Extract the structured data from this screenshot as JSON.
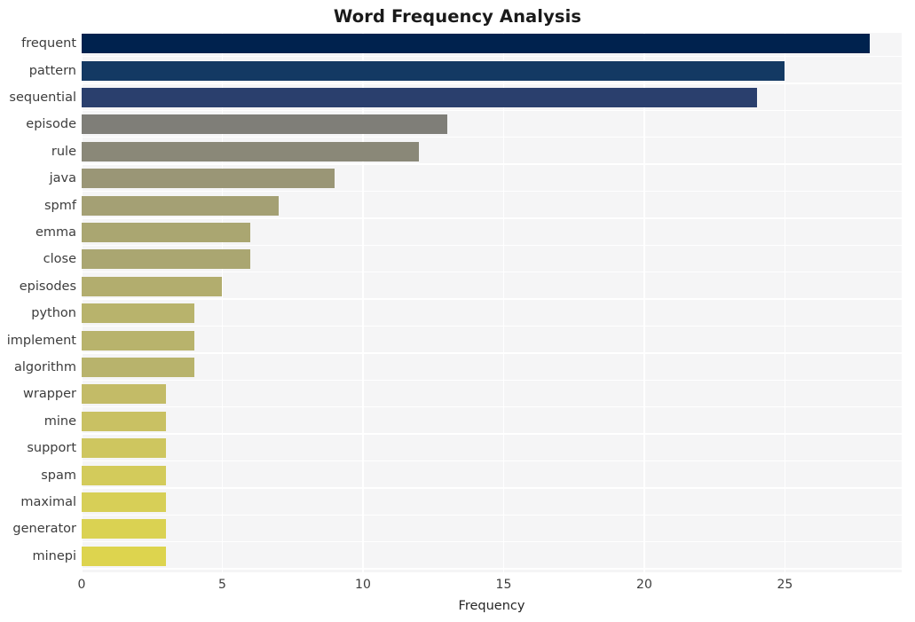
{
  "chart_data": {
    "type": "bar",
    "orientation": "horizontal",
    "title": "Word Frequency Analysis",
    "xlabel": "Frequency",
    "ylabel": "",
    "categories": [
      "frequent",
      "pattern",
      "sequential",
      "episode",
      "rule",
      "java",
      "spmf",
      "emma",
      "close",
      "episodes",
      "python",
      "implement",
      "algorithm",
      "wrapper",
      "mine",
      "support",
      "spam",
      "maximal",
      "generator",
      "minepi"
    ],
    "values": [
      28,
      25,
      24,
      13,
      12,
      9,
      7,
      6,
      6,
      5,
      4,
      4,
      4,
      3,
      3,
      3,
      3,
      3,
      3,
      3
    ],
    "bar_colors": [
      "#00224e",
      "#133963",
      "#2a3f6d",
      "#7f7e78",
      "#8a8878",
      "#9a9676",
      "#a4a074",
      "#aaa671",
      "#aaa671",
      "#b2ad6e",
      "#b8b36c",
      "#b8b36c",
      "#b8b36c",
      "#c3bb67",
      "#c9c163",
      "#cec65f",
      "#d3cb5b",
      "#d7cf57",
      "#dad252",
      "#ddd44e"
    ],
    "colormap": "cividis",
    "xlim": [
      0,
      29.15
    ],
    "ylim_count": 20,
    "xticks": [
      0,
      5,
      10,
      15,
      20,
      25
    ],
    "xtick_labels": [
      "0",
      "5",
      "10",
      "15",
      "20",
      "25"
    ],
    "grid": true,
    "grid_color": "#ffffff",
    "plot_background": "#f5f5f6",
    "figure_background": "#ffffff",
    "legend": null,
    "annotations": []
  }
}
